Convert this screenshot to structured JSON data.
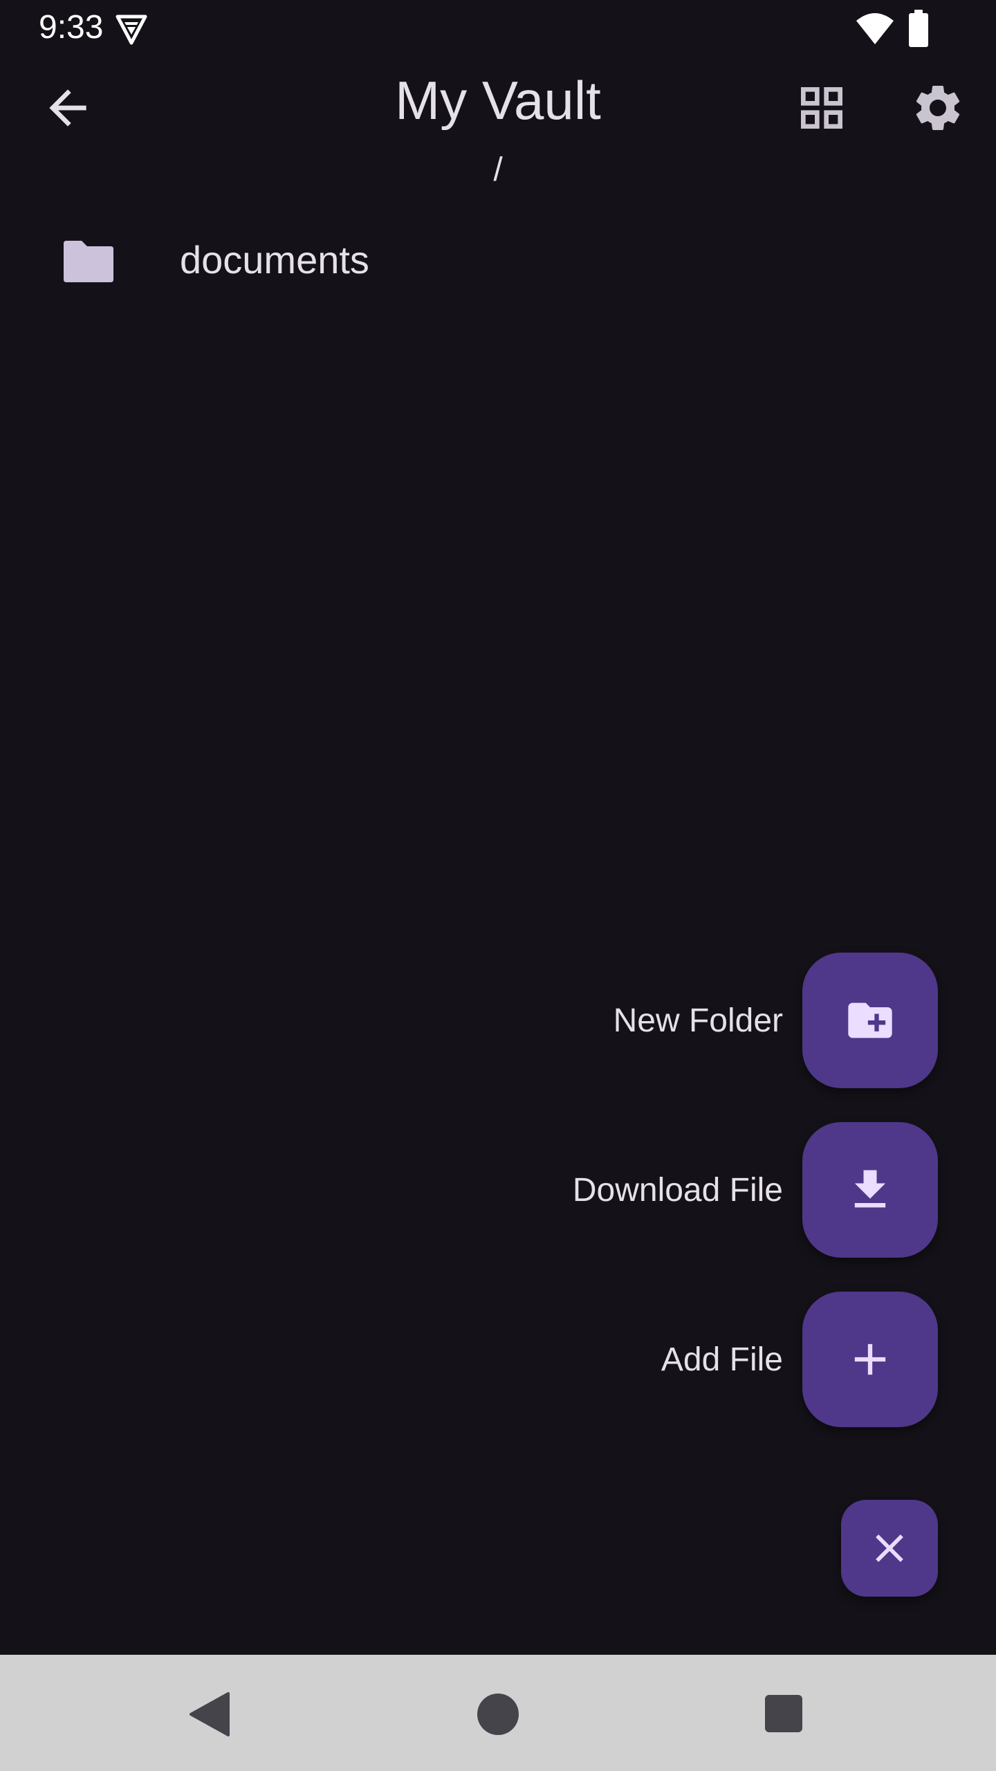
{
  "status_bar": {
    "time": "9:33",
    "icons": [
      "vpn-icon",
      "wifi-icon",
      "battery-icon"
    ]
  },
  "app_bar": {
    "title": "My Vault",
    "back_icon": "arrow-back-icon",
    "actions": [
      "grid-view-icon",
      "settings-icon"
    ]
  },
  "path": "/",
  "files": [
    {
      "name": "documents",
      "type": "folder",
      "icon": "folder-icon"
    }
  ],
  "speed_dial": {
    "actions": [
      {
        "label": "New Folder",
        "icon": "create-new-folder-icon"
      },
      {
        "label": "Download File",
        "icon": "download-icon"
      },
      {
        "label": "Add File",
        "icon": "add-icon"
      }
    ],
    "close_icon": "close-icon"
  },
  "colors": {
    "background": "#141218",
    "fab": "#4f378a",
    "fab_icon": "#eaddff",
    "text": "#e6e0e9",
    "nav_bar": "#d1d1d1"
  },
  "nav_bar": {
    "buttons": [
      "nav-back-icon",
      "nav-home-icon",
      "nav-recents-icon"
    ]
  }
}
